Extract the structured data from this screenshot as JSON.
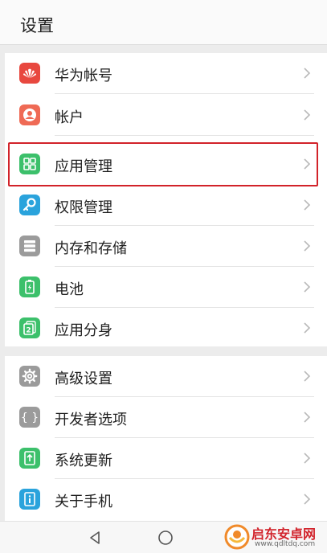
{
  "header": {
    "title": "设置"
  },
  "group1": [
    {
      "label": "华为帐号",
      "icon": "huawei-logo-icon",
      "color": "#e8483f"
    },
    {
      "label": "帐户",
      "icon": "account-icon",
      "color": "#ef6a55"
    },
    {
      "label": "应用管理",
      "icon": "app-grid-icon",
      "color": "#3cc06b"
    },
    {
      "label": "权限管理",
      "icon": "key-icon",
      "color": "#2aa3dc"
    },
    {
      "label": "内存和存储",
      "icon": "storage-icon",
      "color": "#9b9b9b"
    },
    {
      "label": "电池",
      "icon": "battery-icon",
      "color": "#3cc06b"
    },
    {
      "label": "应用分身",
      "icon": "app-twin-icon",
      "color": "#3cc06b"
    }
  ],
  "group2": [
    {
      "label": "高级设置",
      "icon": "gear-icon",
      "color": "#9b9b9b"
    },
    {
      "label": "开发者选项",
      "icon": "braces-icon",
      "color": "#9b9b9b"
    },
    {
      "label": "系统更新",
      "icon": "update-icon",
      "color": "#3cc06b"
    },
    {
      "label": "关于手机",
      "icon": "info-icon",
      "color": "#2aa3dc"
    }
  ],
  "highlight_color": "#d2232a",
  "watermark": {
    "line1": "启东安卓网",
    "line2": "www.qdltdq.com"
  }
}
